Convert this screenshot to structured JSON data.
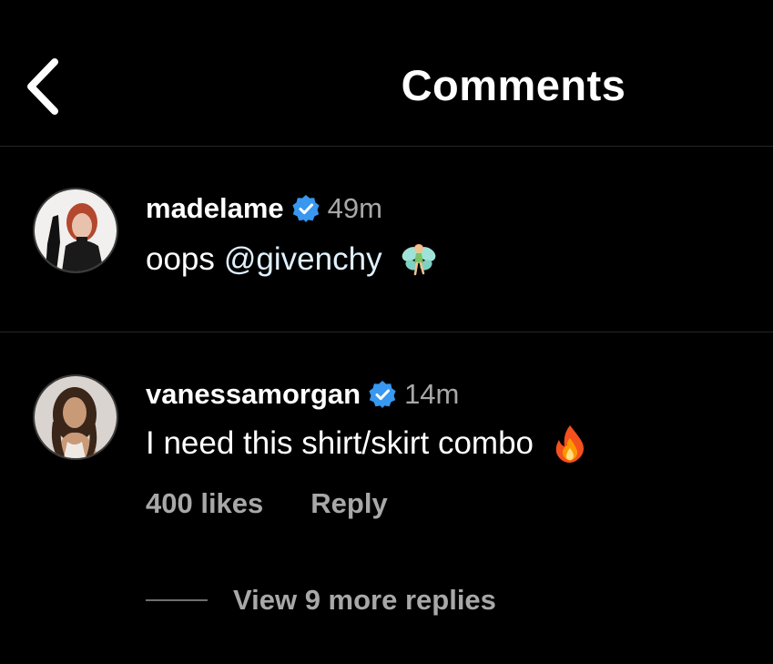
{
  "header": {
    "title": "Comments",
    "back_icon": "chevron-left-icon"
  },
  "comments": [
    {
      "username": "madelame",
      "verified": true,
      "time": "49m",
      "text_prefix": "oops",
      "mention": "@givenchy",
      "emoji": "fairy-emoji"
    },
    {
      "username": "vanessamorgan",
      "verified": true,
      "time": "14m",
      "text": "I need this shirt/skirt combo",
      "emoji": "fire-emoji",
      "likes": "400 likes",
      "reply_label": "Reply",
      "view_replies": "View 9 more replies"
    }
  ],
  "colors": {
    "background": "#000000",
    "text": "#ffffff",
    "secondary_text": "#a8a8a8",
    "verified_badge": "#3897f0",
    "divider": "#262626"
  }
}
